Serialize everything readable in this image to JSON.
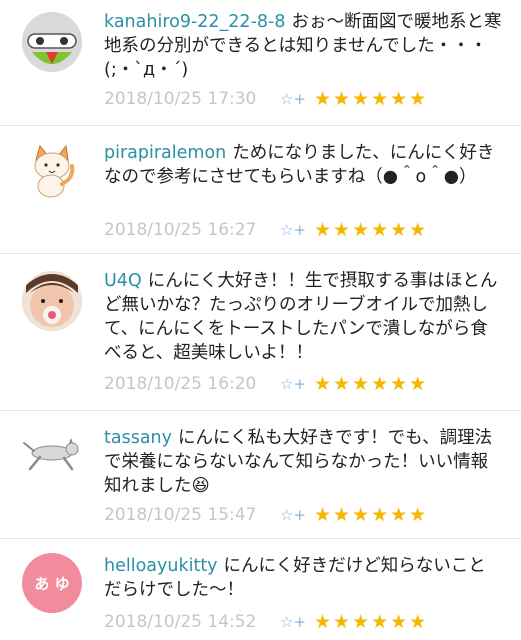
{
  "comments": [
    {
      "user": "kanahiro9-22_22-8-8",
      "text": "おぉ〜断面図で暖地系と寒地系の分別ができるとは知りませんでした・・・(;・`д・´)",
      "time": "2018/10/25 17:30",
      "fav": "☆+",
      "stars": "★★★★★★",
      "avatar": "robot-face"
    },
    {
      "user": "pirapiralemon",
      "text": "ためになりました、にんにく好きなので参考にさせてもらいますね（●＾o＾●）",
      "time": "2018/10/25 16:27",
      "fav": "☆+",
      "stars": "★★★★★★",
      "avatar": "cat-illustration"
    },
    {
      "user": "U4Q",
      "text": "にんにく大好き！！生で摂取する事はほとんど無いかな？たっぷりのオリーブオイルで加熱して、にんにくをトーストしたパンで潰しながら食べると、超美味しいよ！！",
      "time": "2018/10/25 16:20",
      "fav": "☆+",
      "stars": "★★★★★★",
      "avatar": "baby-photo"
    },
    {
      "user": "tassany",
      "text": "にんにく私も大好きです！でも、調理法で栄養にならないなんて知らなかった！いい情報知れました😆",
      "time": "2018/10/25 15:47",
      "fav": "☆+",
      "stars": "★★★★★★",
      "avatar": "running-cat"
    },
    {
      "user": "helloayukitty",
      "text": "にんにく好きだけど知らないことだらけでした〜！",
      "time": "2018/10/25 14:52",
      "fav": "☆+",
      "stars": "★★★★★★",
      "avatar": "initials-badge",
      "avatar_text": "あ ゆ"
    }
  ]
}
